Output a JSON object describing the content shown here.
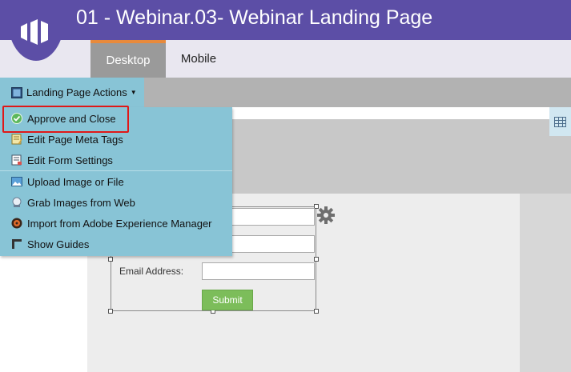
{
  "header": {
    "title": "01 - Webinar.03- Webinar Landing Page"
  },
  "tabs": [
    {
      "label": "Desktop",
      "active": true
    },
    {
      "label": "Mobile",
      "active": false
    }
  ],
  "toolbar": {
    "actions_label": "Landing Page Actions"
  },
  "menu": {
    "items": [
      {
        "label": "Approve and Close",
        "icon": "check-circle-icon"
      },
      {
        "label": "Edit Page Meta Tags",
        "icon": "meta-tags-icon"
      },
      {
        "label": "Edit Form Settings",
        "icon": "form-settings-icon"
      },
      {
        "label": "Upload Image or File",
        "icon": "upload-image-icon"
      },
      {
        "label": "Grab Images from Web",
        "icon": "grab-images-icon"
      },
      {
        "label": "Import from Adobe Experience Manager",
        "icon": "adobe-aem-icon"
      },
      {
        "label": "Show Guides",
        "icon": "guides-icon"
      }
    ]
  },
  "form": {
    "email_label": "Email Address:",
    "submit_label": "Submit"
  },
  "colors": {
    "brand": "#5c4ea6",
    "menu": "#88c4d6",
    "accent": "#e88a3c",
    "highlight": "#e01818",
    "submit": "#7cbd5a"
  }
}
